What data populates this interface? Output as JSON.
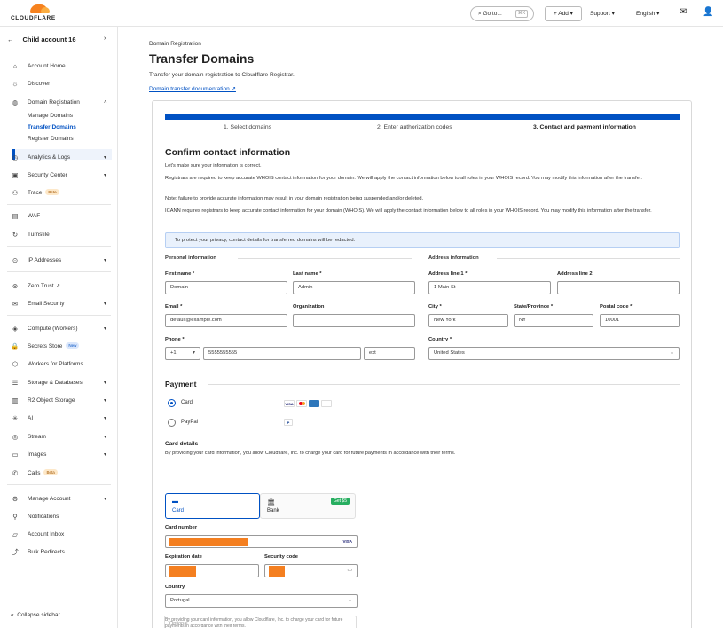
{
  "topbar": {
    "logo_text": "CLOUDFLARE",
    "goto_label": "Go to...",
    "goto_shortcut": "⌘K",
    "add_label": "+ Add",
    "support_label": "Support",
    "language_label": "English"
  },
  "sidebar": {
    "account_name": "Child account 16",
    "items": [
      {
        "label": "Account Home"
      },
      {
        "label": "Discover"
      },
      {
        "label": "Domain Registration"
      },
      {
        "label": "Analytics & Logs"
      },
      {
        "label": "Security Center"
      },
      {
        "label": "Trace",
        "badge": "Beta"
      },
      {
        "label": "WAF"
      },
      {
        "label": "Turnstile"
      },
      {
        "label": "IP Addresses"
      },
      {
        "label": "Zero Trust"
      },
      {
        "label": "Email Security"
      },
      {
        "label": "Compute (Workers)"
      },
      {
        "label": "Secrets Store",
        "badge": "New"
      },
      {
        "label": "Workers for Platforms"
      },
      {
        "label": "Storage & Databases"
      },
      {
        "label": "R2 Object Storage"
      },
      {
        "label": "AI"
      },
      {
        "label": "Stream"
      },
      {
        "label": "Images"
      },
      {
        "label": "Calls",
        "badge": "Beta"
      },
      {
        "label": "Manage Account"
      },
      {
        "label": "Notifications"
      },
      {
        "label": "Account Inbox"
      },
      {
        "label": "Bulk Redirects"
      }
    ],
    "sub_items": [
      "Manage Domains",
      "Transfer Domains",
      "Register Domains"
    ],
    "collapse_label": "Collapse sidebar"
  },
  "page": {
    "breadcrumb": "Domain Registration",
    "title": "Transfer Domains",
    "subtitle": "Transfer your domain registration to Cloudflare Registrar.",
    "doc_link": "Domain transfer documentation ↗"
  },
  "steps": [
    "1. Select domains",
    "2. Enter authorization codes",
    "3. Contact and payment information"
  ],
  "contact": {
    "heading": "Confirm contact information",
    "intro": "Let's make sure your information is correct.",
    "p1": "Registrars are required to keep accurate WHOIS contact information for your domain. We will apply the contact information below to all roles in your WHOIS record. You may modify this information after the transfer.",
    "p2": "Note: failure to provide accurate information may result in your domain registration being suspended and/or deleted.",
    "p3": "ICANN requires registrars to keep accurate contact information for your domain (WHOIS). We will apply the contact information below to all roles in your WHOIS record. You may modify this information after the transfer.",
    "notice": "To protect your privacy, contact details for transferred domains will be redacted.",
    "personal_heading": "Personal information",
    "address_heading": "Address information",
    "first_name_label": "First name *",
    "first_name": "Domain",
    "last_name_label": "Last name *",
    "last_name": "Admin",
    "email_label": "Email *",
    "email": "default@example.com",
    "org_label": "Organization",
    "org": "",
    "phone_label": "Phone *",
    "phone_code": "+1",
    "phone": "5555555555",
    "phone_ext": "ext",
    "addr1_label": "Address line 1 *",
    "addr1": "1 Main St",
    "addr2_label": "Address line 2",
    "addr2": "",
    "city_label": "City *",
    "city": "New York",
    "state_label": "State/Province *",
    "state": "NY",
    "postal_label": "Postal code *",
    "postal": "10001",
    "country_label": "Country *",
    "country": "United States"
  },
  "payment": {
    "heading": "Payment",
    "card_option": "Card",
    "paypal_option": "PayPal",
    "details_heading": "Card details",
    "details_sub": "By providing your card information, you allow Cloudflare, Inc. to charge your card for future payments in accordance with their terms.",
    "tab_card": "Card",
    "tab_bank": "Bank",
    "bank_badge": "Get $5",
    "card_number_label": "Card number",
    "expiration_label": "Expiration date",
    "security_label": "Security code",
    "country_label": "Country",
    "country": "Portugal",
    "fine_print": "By providing your card information, you allow Cloudflare, Inc. to charge your card for future payments in accordance with their terms.",
    "optional_placeholder": "Optional",
    "visa_text": "VISA"
  },
  "colors": {
    "accent": "#0051c3",
    "brand": "#f6821f",
    "redaction": "#f47f20"
  }
}
